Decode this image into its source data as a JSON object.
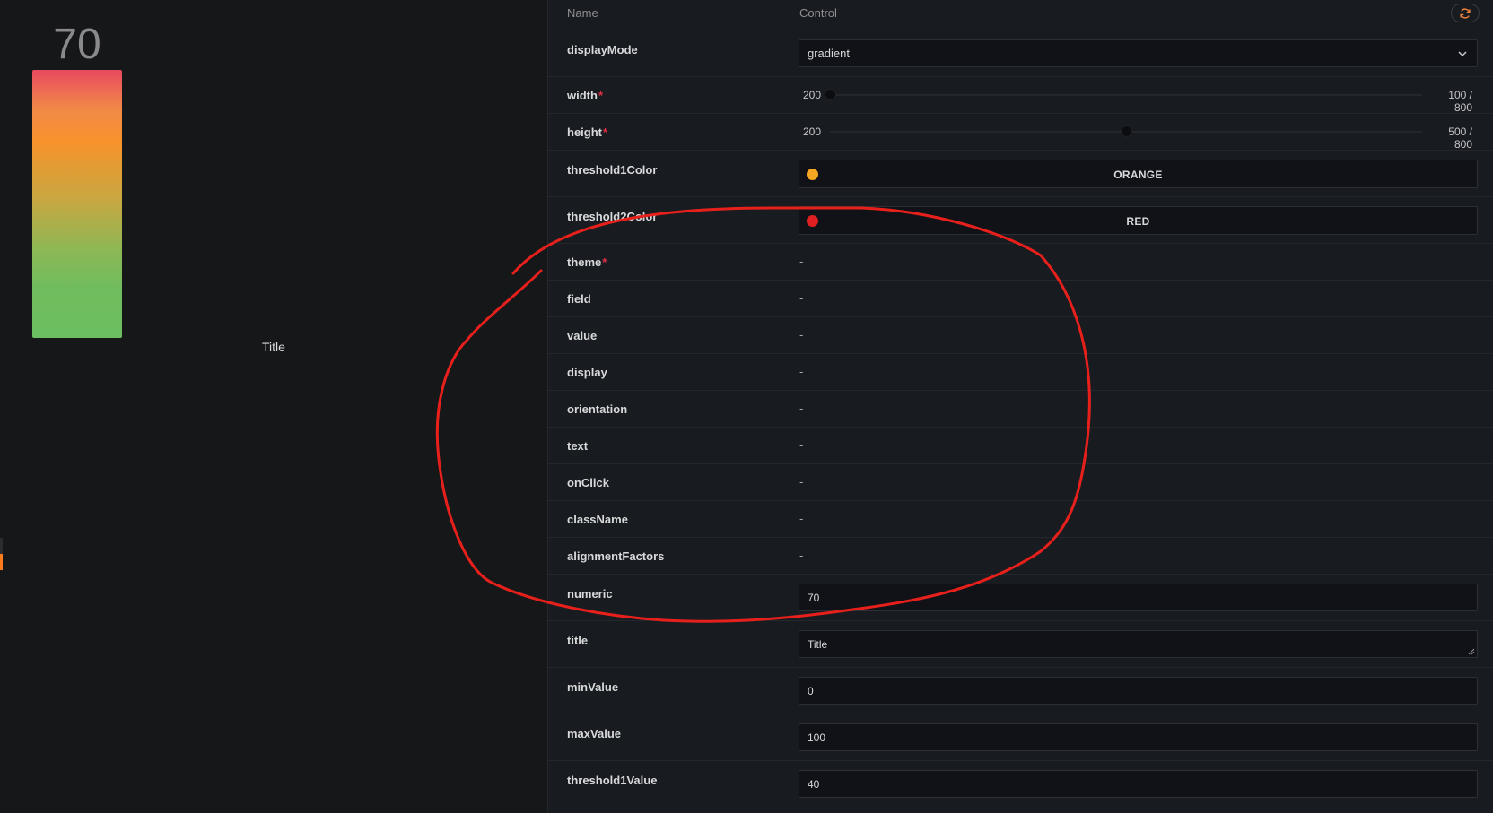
{
  "preview": {
    "gauge_value": "70",
    "title": "Title",
    "gradient_colors": [
      "#e84a5f",
      "#f7932b",
      "#6cbf60"
    ]
  },
  "table": {
    "header_name": "Name",
    "header_control": "Control",
    "reset_icon": "refresh-icon",
    "rows": {
      "displayMode": {
        "name": "displayMode",
        "value": "gradient"
      },
      "width": {
        "name": "width",
        "required": "*",
        "min": "200",
        "value_max": "100 / 800",
        "level": 0.0
      },
      "height": {
        "name": "height",
        "required": "*",
        "min": "200",
        "value_max": "500 / 800",
        "level": 0.5
      },
      "threshold1Color": {
        "name": "threshold1Color",
        "label": "ORANGE",
        "color": "#f5a623"
      },
      "threshold2Color": {
        "name": "threshold2Color",
        "label": "RED",
        "color": "#e02020"
      },
      "theme": {
        "name": "theme",
        "required": "*",
        "value": "-"
      },
      "field": {
        "name": "field",
        "value": "-"
      },
      "value": {
        "name": "value",
        "value": "-"
      },
      "display": {
        "name": "display",
        "value": "-"
      },
      "orientation": {
        "name": "orientation",
        "value": "-"
      },
      "text": {
        "name": "text",
        "value": "-"
      },
      "onClick": {
        "name": "onClick",
        "value": "-"
      },
      "className": {
        "name": "className",
        "value": "-"
      },
      "alignmentFactors": {
        "name": "alignmentFactors",
        "value": "-"
      },
      "numeric": {
        "name": "numeric",
        "value": "70"
      },
      "title": {
        "name": "title",
        "value": "Title"
      },
      "minValue": {
        "name": "minValue",
        "value": "0"
      },
      "maxValue": {
        "name": "maxValue",
        "value": "100"
      },
      "threshold1Value": {
        "name": "threshold1Value",
        "value": "40"
      }
    }
  },
  "annotation": {
    "color": "#e8201c"
  }
}
